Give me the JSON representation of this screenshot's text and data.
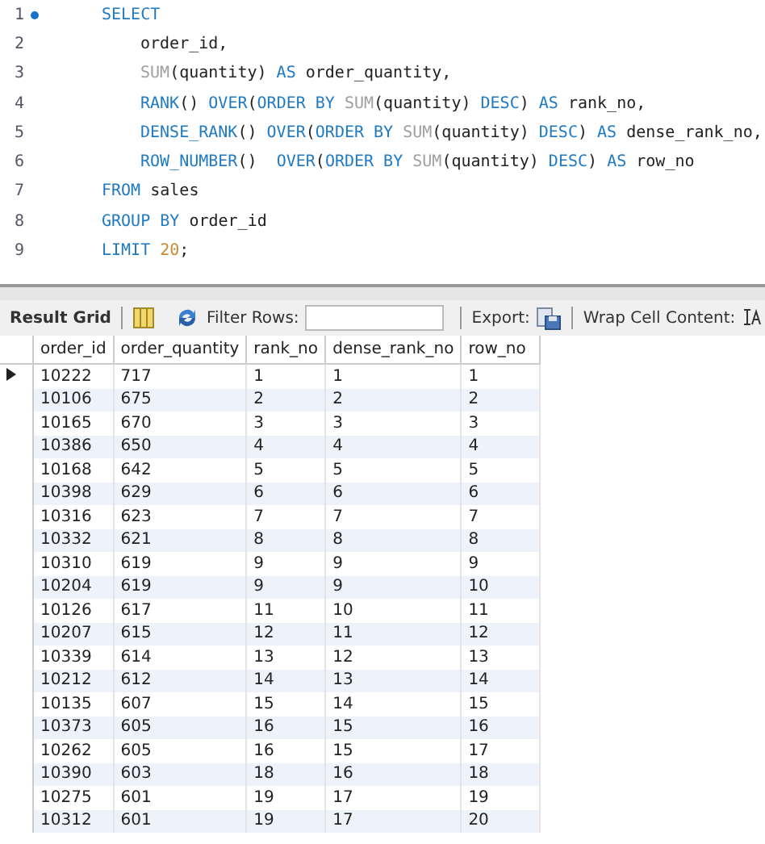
{
  "editor": {
    "lines": [
      {
        "number": "1",
        "current": true,
        "indented": false,
        "tokens": [
          {
            "kind": "keyword",
            "text": "SELECT"
          }
        ]
      },
      {
        "number": "2",
        "current": false,
        "indented": true,
        "tokens": [
          {
            "kind": "plain",
            "text": "order_id,"
          }
        ]
      },
      {
        "number": "3",
        "current": false,
        "indented": true,
        "tokens": [
          {
            "kind": "function",
            "text": "SUM"
          },
          {
            "kind": "plain",
            "text": "(quantity) "
          },
          {
            "kind": "keyword",
            "text": "AS"
          },
          {
            "kind": "plain",
            "text": " order_quantity,"
          }
        ]
      },
      {
        "number": "4",
        "current": false,
        "indented": true,
        "tokens": [
          {
            "kind": "keyword",
            "text": "RANK"
          },
          {
            "kind": "plain",
            "text": "() "
          },
          {
            "kind": "keyword",
            "text": "OVER"
          },
          {
            "kind": "plain",
            "text": "("
          },
          {
            "kind": "keyword",
            "text": "ORDER BY "
          },
          {
            "kind": "function",
            "text": "SUM"
          },
          {
            "kind": "plain",
            "text": "(quantity) "
          },
          {
            "kind": "keyword",
            "text": "DESC"
          },
          {
            "kind": "plain",
            "text": ") "
          },
          {
            "kind": "keyword",
            "text": "AS"
          },
          {
            "kind": "plain",
            "text": " rank_no,"
          }
        ]
      },
      {
        "number": "5",
        "current": false,
        "indented": true,
        "tokens": [
          {
            "kind": "keyword",
            "text": "DENSE_RANK"
          },
          {
            "kind": "plain",
            "text": "() "
          },
          {
            "kind": "keyword",
            "text": "OVER"
          },
          {
            "kind": "plain",
            "text": "("
          },
          {
            "kind": "keyword",
            "text": "ORDER BY "
          },
          {
            "kind": "function",
            "text": "SUM"
          },
          {
            "kind": "plain",
            "text": "(quantity) "
          },
          {
            "kind": "keyword",
            "text": "DESC"
          },
          {
            "kind": "plain",
            "text": ") "
          },
          {
            "kind": "keyword",
            "text": "AS"
          },
          {
            "kind": "plain",
            "text": " dense_rank_no,"
          }
        ]
      },
      {
        "number": "6",
        "current": false,
        "indented": true,
        "tokens": [
          {
            "kind": "keyword",
            "text": "ROW_NUMBER"
          },
          {
            "kind": "plain",
            "text": "()  "
          },
          {
            "kind": "keyword",
            "text": "OVER"
          },
          {
            "kind": "plain",
            "text": "("
          },
          {
            "kind": "keyword",
            "text": "ORDER BY "
          },
          {
            "kind": "function",
            "text": "SUM"
          },
          {
            "kind": "plain",
            "text": "(quantity) "
          },
          {
            "kind": "keyword",
            "text": "DESC"
          },
          {
            "kind": "plain",
            "text": ") "
          },
          {
            "kind": "keyword",
            "text": "AS"
          },
          {
            "kind": "plain",
            "text": " row_no"
          }
        ]
      },
      {
        "number": "7",
        "current": false,
        "indented": false,
        "tokens": [
          {
            "kind": "keyword",
            "text": "FROM"
          },
          {
            "kind": "plain",
            "text": " sales"
          }
        ]
      },
      {
        "number": "8",
        "current": false,
        "indented": false,
        "tokens": [
          {
            "kind": "keyword",
            "text": "GROUP BY"
          },
          {
            "kind": "plain",
            "text": " order_id"
          }
        ]
      },
      {
        "number": "9",
        "current": false,
        "indented": false,
        "tokens": [
          {
            "kind": "keyword",
            "text": "LIMIT "
          },
          {
            "kind": "number",
            "text": "20"
          },
          {
            "kind": "plain",
            "text": ";"
          }
        ]
      }
    ]
  },
  "toolbar": {
    "result_grid": "Result Grid",
    "filter_label": "Filter Rows:",
    "export_label": "Export:",
    "wrap_label": "Wrap Cell Content:"
  },
  "table": {
    "columns": [
      "order_id",
      "order_quantity",
      "rank_no",
      "dense_rank_no",
      "row_no"
    ],
    "rows": [
      {
        "selected": true,
        "cells": [
          "10222",
          "717",
          "1",
          "1",
          "1"
        ]
      },
      {
        "selected": false,
        "cells": [
          "10106",
          "675",
          "2",
          "2",
          "2"
        ]
      },
      {
        "selected": false,
        "cells": [
          "10165",
          "670",
          "3",
          "3",
          "3"
        ]
      },
      {
        "selected": false,
        "cells": [
          "10386",
          "650",
          "4",
          "4",
          "4"
        ]
      },
      {
        "selected": false,
        "cells": [
          "10168",
          "642",
          "5",
          "5",
          "5"
        ]
      },
      {
        "selected": false,
        "cells": [
          "10398",
          "629",
          "6",
          "6",
          "6"
        ]
      },
      {
        "selected": false,
        "cells": [
          "10316",
          "623",
          "7",
          "7",
          "7"
        ]
      },
      {
        "selected": false,
        "cells": [
          "10332",
          "621",
          "8",
          "8",
          "8"
        ]
      },
      {
        "selected": false,
        "cells": [
          "10310",
          "619",
          "9",
          "9",
          "9"
        ]
      },
      {
        "selected": false,
        "cells": [
          "10204",
          "619",
          "9",
          "9",
          "10"
        ]
      },
      {
        "selected": false,
        "cells": [
          "10126",
          "617",
          "11",
          "10",
          "11"
        ]
      },
      {
        "selected": false,
        "cells": [
          "10207",
          "615",
          "12",
          "11",
          "12"
        ]
      },
      {
        "selected": false,
        "cells": [
          "10339",
          "614",
          "13",
          "12",
          "13"
        ]
      },
      {
        "selected": false,
        "cells": [
          "10212",
          "612",
          "14",
          "13",
          "14"
        ]
      },
      {
        "selected": false,
        "cells": [
          "10135",
          "607",
          "15",
          "14",
          "15"
        ]
      },
      {
        "selected": false,
        "cells": [
          "10373",
          "605",
          "16",
          "15",
          "16"
        ]
      },
      {
        "selected": false,
        "cells": [
          "10262",
          "605",
          "16",
          "15",
          "17"
        ]
      },
      {
        "selected": false,
        "cells": [
          "10390",
          "603",
          "18",
          "16",
          "18"
        ]
      },
      {
        "selected": false,
        "cells": [
          "10275",
          "601",
          "19",
          "17",
          "19"
        ]
      },
      {
        "selected": false,
        "cells": [
          "10312",
          "601",
          "19",
          "17",
          "20"
        ]
      }
    ]
  }
}
